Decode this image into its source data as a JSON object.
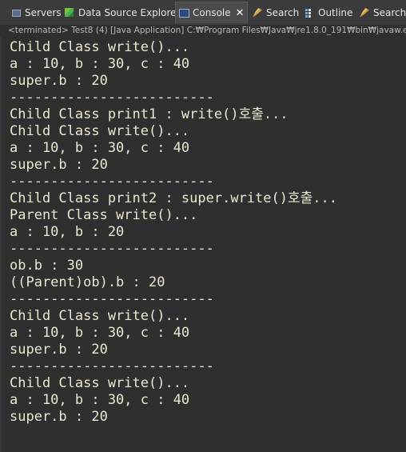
{
  "tabs": [
    {
      "label": "Servers",
      "icon": "servers-icon"
    },
    {
      "label": "Data Source Explorer",
      "icon": "data-source-explorer-icon"
    },
    {
      "label": "Console",
      "icon": "console-icon",
      "active": true,
      "close": "✕"
    },
    {
      "label": "Search",
      "icon": "search-icon"
    },
    {
      "label": "Outline",
      "icon": "outline-icon"
    },
    {
      "label": "Search",
      "icon": "search-icon"
    }
  ],
  "status_line": "<terminated> Test8 (4) [Java Application] C:₩Program Files₩Java₩jre1.8.0_191₩bin₩javaw.e",
  "console_lines": [
    "Child Class write()...",
    "a : 10, b : 30, c : 40",
    "super.b : 20",
    "-------------------------",
    "Child Class print1 : write()호출...",
    "Child Class write()...",
    "a : 10, b : 30, c : 40",
    "super.b : 20",
    "-------------------------",
    "Child Class print2 : super.write()호출...",
    "Parent Class write()...",
    "a : 10, b : 20",
    "-------------------------",
    "ob.b : 30",
    "((Parent)ob).b : 20",
    "-------------------------",
    "Child Class write()...",
    "a : 10, b : 30, c : 40",
    "super.b : 20",
    "-------------------------",
    "Child Class write()...",
    "a : 10, b : 30, c : 40",
    "super.b : 20"
  ],
  "colors": {
    "background": "#2f2f2f",
    "text": "#ece7cf",
    "tabbar": "#3b3b3b",
    "status": "#b8b8b8"
  }
}
